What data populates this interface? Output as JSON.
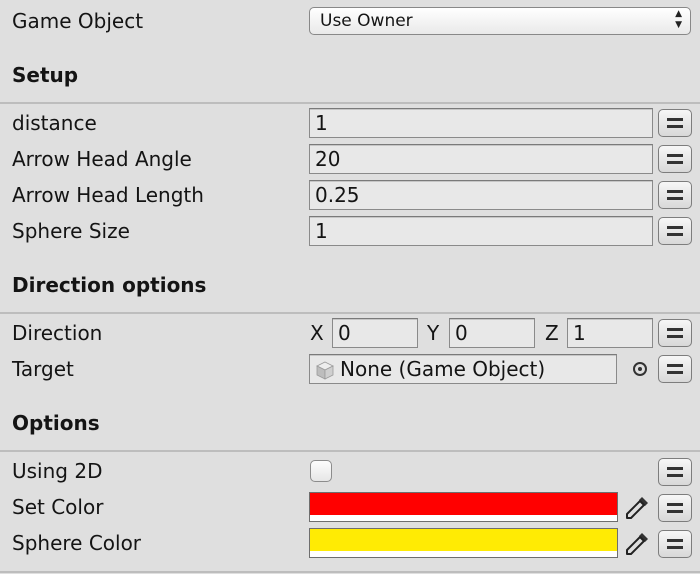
{
  "header": {
    "game_object_label": "Game Object",
    "game_object_value": "Use Owner"
  },
  "setup": {
    "title": "Setup",
    "fields": [
      {
        "label": "distance",
        "value": "1"
      },
      {
        "label": "Arrow Head Angle",
        "value": "20"
      },
      {
        "label": "Arrow Head Length",
        "value": "0.25"
      },
      {
        "label": "Sphere Size",
        "value": "1"
      }
    ]
  },
  "direction_options": {
    "title": "Direction options",
    "direction": {
      "label": "Direction",
      "x_label": "X",
      "x": "0",
      "y_label": "Y",
      "y": "0",
      "z_label": "Z",
      "z": "1"
    },
    "target": {
      "label": "Target",
      "value": "None (Game Object)"
    }
  },
  "options": {
    "title": "Options",
    "using_2d": {
      "label": "Using 2D",
      "checked": false
    },
    "set_color": {
      "label": "Set Color",
      "color": "#ff0000"
    },
    "sphere_color": {
      "label": "Sphere Color",
      "color": "#ffeb04"
    }
  },
  "icons": {
    "menu": "hamburger-menu-icon",
    "picker": "eyedropper-icon",
    "object": "cube-icon",
    "target": "object-picker-icon"
  }
}
